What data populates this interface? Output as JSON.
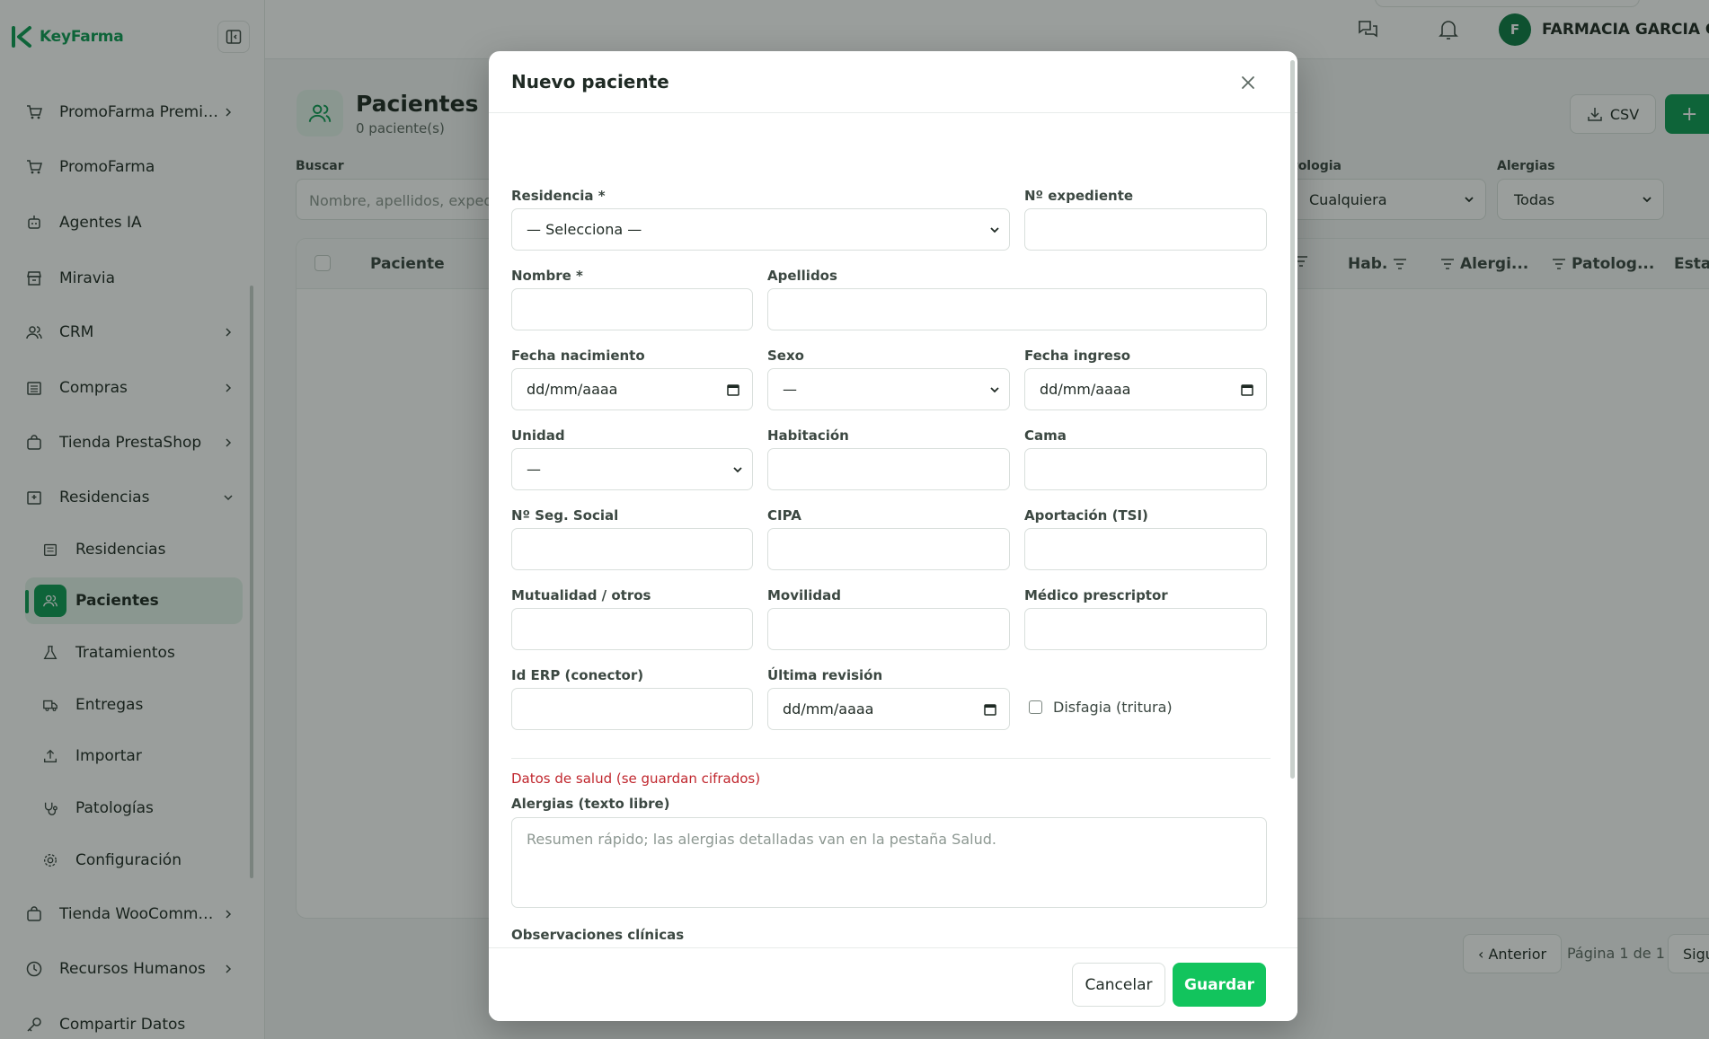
{
  "app": {
    "brand": "KeyFarma"
  },
  "sidebar": {
    "items": [
      {
        "label": "PromoFarma Premi…",
        "icon": "cart-icon",
        "chevron": true
      },
      {
        "label": "PromoFarma",
        "icon": "cart-icon",
        "chevron": false
      },
      {
        "label": "Agentes IA",
        "icon": "robot-icon",
        "chevron": false
      },
      {
        "label": "Miravia",
        "icon": "store-icon",
        "chevron": false
      },
      {
        "label": "CRM",
        "icon": "users-icon",
        "chevron": true
      },
      {
        "label": "Compras",
        "icon": "building-icon",
        "chevron": true
      },
      {
        "label": "Tienda PrestaShop",
        "icon": "bag-icon",
        "chevron": true
      },
      {
        "label": "Residencias",
        "icon": "hospital-icon",
        "chevron": "down"
      },
      {
        "label": "Tienda WooComm…",
        "icon": "bag-icon",
        "chevron": true
      },
      {
        "label": "Recursos Humanos",
        "icon": "clock-icon",
        "chevron": true
      },
      {
        "label": "Compartir Datos",
        "icon": "key-icon",
        "chevron": false
      }
    ],
    "subitems": [
      {
        "label": "Residencias",
        "icon": "building-icon",
        "active": false
      },
      {
        "label": "Pacientes",
        "icon": "users-icon",
        "active": true
      },
      {
        "label": "Tratamientos",
        "icon": "flask-icon",
        "active": false
      },
      {
        "label": "Entregas",
        "icon": "truck-icon",
        "active": false
      },
      {
        "label": "Importar",
        "icon": "upload-icon",
        "active": false
      },
      {
        "label": "Patologías",
        "icon": "stethoscope-icon",
        "active": false
      },
      {
        "label": "Configuración",
        "icon": "gear-icon",
        "active": false
      }
    ]
  },
  "topbar": {
    "user_initial": "F",
    "user_name": "FARMACIA GARCIA GAR"
  },
  "page": {
    "title": "Pacientes",
    "subtitle": "0 paciente(s)",
    "csv_label": "CSV",
    "new_label": "+",
    "search_label": "Buscar",
    "search_placeholder": "Nombre, apellidos, expedie",
    "pathology_label": "tologia",
    "pathology_value": "Cualquiera",
    "allergies_label": "Alergias",
    "allergies_value": "Todas",
    "columns": [
      "Paciente",
      "Hab.",
      "Alergi...",
      "Patolog...",
      "Esta"
    ],
    "pager_prev": "‹ Anterior",
    "pager_info": "Página 1 de 1",
    "pager_next": "Sigu"
  },
  "modal": {
    "title": "Nuevo paciente",
    "fields": {
      "residencia": {
        "label": "Residencia *",
        "value": "— Selecciona —"
      },
      "expediente": {
        "label": "Nº expediente",
        "value": ""
      },
      "nombre": {
        "label": "Nombre *",
        "value": ""
      },
      "apellidos": {
        "label": "Apellidos",
        "value": ""
      },
      "fecha_nacimiento": {
        "label": "Fecha nacimiento",
        "value": "dd/mm/aaaa"
      },
      "sexo": {
        "label": "Sexo",
        "value": "—"
      },
      "fecha_ingreso": {
        "label": "Fecha ingreso",
        "value": "dd/mm/aaaa"
      },
      "unidad": {
        "label": "Unidad",
        "value": "—"
      },
      "habitacion": {
        "label": "Habitación",
        "value": ""
      },
      "cama": {
        "label": "Cama",
        "value": ""
      },
      "seg_social": {
        "label": "Nº Seg. Social",
        "value": ""
      },
      "cipa": {
        "label": "CIPA",
        "value": ""
      },
      "aportacion": {
        "label": "Aportación (TSI)",
        "value": ""
      },
      "mutualidad": {
        "label": "Mutualidad / otros",
        "value": ""
      },
      "movilidad": {
        "label": "Movilidad",
        "value": ""
      },
      "medico": {
        "label": "Médico prescriptor",
        "value": ""
      },
      "id_erp": {
        "label": "Id ERP (conector)",
        "value": ""
      },
      "ultima_revision": {
        "label": "Última revisión",
        "value": "dd/mm/aaaa"
      },
      "disfagia": {
        "label": "Disfagia (tritura)",
        "checked": false
      }
    },
    "health_note": "Datos de salud (se guardan cifrados)",
    "alergias_label": "Alergias (texto libre)",
    "alergias_placeholder": "Resumen rápido; las alergias detalladas van en la pestaña Salud.",
    "observaciones_label": "Observaciones clínicas",
    "cancel_label": "Cancelar",
    "save_label": "Guardar"
  },
  "colors": {
    "accent": "#0e9b55",
    "save": "#12c45d",
    "danger": "#c0262d"
  }
}
